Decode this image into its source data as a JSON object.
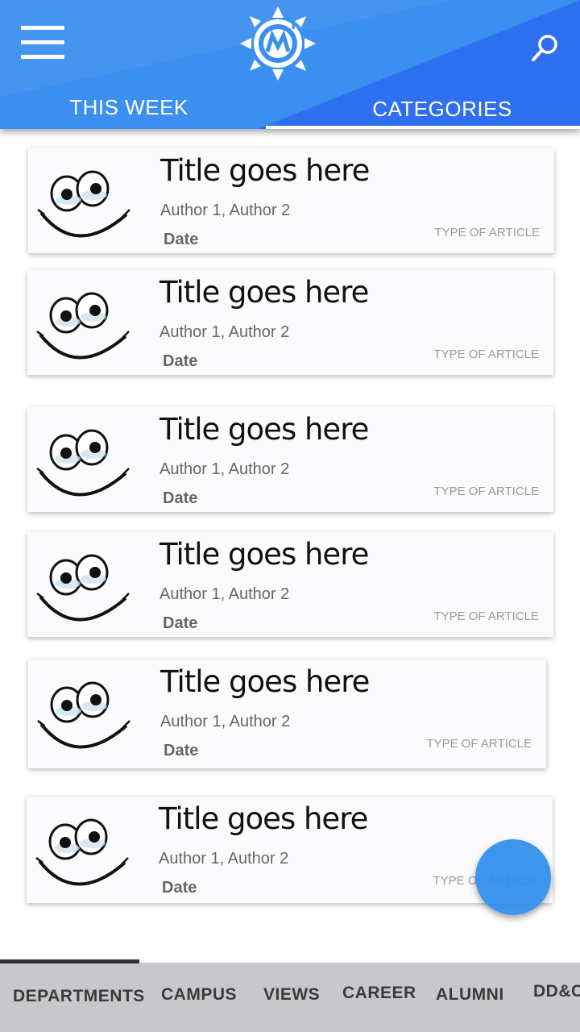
{
  "header": {
    "tabs": [
      {
        "label": "THIS WEEK"
      },
      {
        "label": "CATEGORIES"
      }
    ],
    "active_tab": "CATEGORIES",
    "colors": {
      "primary": "#3a8ff0",
      "accent": "#2f6ff2"
    }
  },
  "articles": [
    {
      "title": "Title goes here",
      "authors": "Author 1, Author 2",
      "date": "Date",
      "type": "TYPE OF ARTICLE"
    },
    {
      "title": "Title goes here",
      "authors": "Author 1, Author 2",
      "date": "Date",
      "type": "TYPE OF ARTICLE"
    },
    {
      "title": "Title goes here",
      "authors": "Author 1, Author 2",
      "date": "Date",
      "type": "TYPE OF ARTICLE"
    },
    {
      "title": "Title goes here",
      "authors": "Author 1, Author 2",
      "date": "Date",
      "type": "TYPE OF ARTICLE"
    },
    {
      "title": "Title goes here",
      "authors": "Author 1, Author 2",
      "date": "Date",
      "type": "TYPE OF ARTICLE"
    },
    {
      "title": "Title goes here",
      "authors": "Author 1, Author 2",
      "date": "Date",
      "type": "TYPE OF ARTICLE"
    }
  ],
  "bottom_nav": {
    "items": [
      {
        "label": "DEPARTMENTS"
      },
      {
        "label": "CAMPUS"
      },
      {
        "label": "VIEWS"
      },
      {
        "label": "CAREER"
      },
      {
        "label": "ALUMNI"
      },
      {
        "label": "DD&C"
      }
    ],
    "active": "DEPARTMENTS"
  },
  "icons": {
    "menu": "hamburger-menu-icon",
    "logo": "sun-logo-icon",
    "search": "search-icon",
    "thumbnail": "smiley-face-icon",
    "fab": "floating-action-button"
  }
}
